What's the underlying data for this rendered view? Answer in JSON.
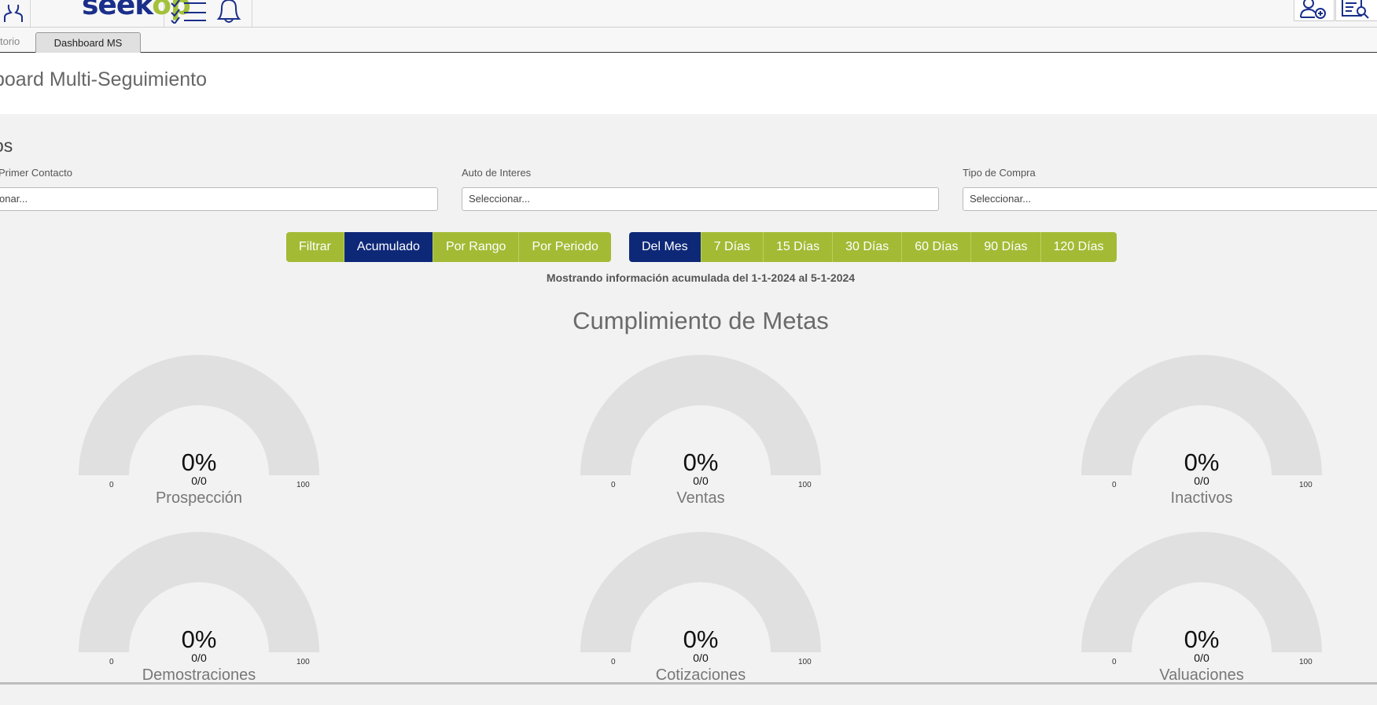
{
  "header": {
    "logo_main": "seek",
    "logo_accent": "op"
  },
  "tabs": {
    "previous": "torio",
    "active": "Dashboard MS"
  },
  "page": {
    "title": "board Multi-Seguimiento"
  },
  "filters": {
    "heading": "os",
    "fields": [
      {
        "label": "Primer Contacto",
        "placeholder": "onar..."
      },
      {
        "label": "Auto de Interes",
        "placeholder": "Seleccionar..."
      },
      {
        "label": "Tipo de Compra",
        "placeholder": "Seleccionar..."
      }
    ]
  },
  "mode_buttons": [
    {
      "label": "Filtrar",
      "active": false
    },
    {
      "label": "Acumulado",
      "active": true
    },
    {
      "label": "Por Rango",
      "active": false
    },
    {
      "label": "Por Periodo",
      "active": false
    }
  ],
  "period_buttons": [
    {
      "label": "Del Mes",
      "active": true
    },
    {
      "label": "7 Días",
      "active": false
    },
    {
      "label": "15 Días",
      "active": false
    },
    {
      "label": "30 Días",
      "active": false
    },
    {
      "label": "60 Días",
      "active": false
    },
    {
      "label": "90 Días",
      "active": false
    },
    {
      "label": "120 Días",
      "active": false
    }
  ],
  "info": "Mostrando información acumulada del 1-1-2024 al 5-1-2024",
  "section_title": "Cumplimiento de Metas",
  "gauges": [
    {
      "name": "Prospección",
      "percent": "0%",
      "fraction": "0/0",
      "min": "0",
      "max": "100",
      "value": 0
    },
    {
      "name": "Ventas",
      "percent": "0%",
      "fraction": "0/0",
      "min": "0",
      "max": "100",
      "value": 0
    },
    {
      "name": "Inactivos",
      "percent": "0%",
      "fraction": "0/0",
      "min": "0",
      "max": "100",
      "value": 0
    },
    {
      "name": "Demostraciones",
      "percent": "0%",
      "fraction": "0/0",
      "min": "0",
      "max": "100",
      "value": 0
    },
    {
      "name": "Cotizaciones",
      "percent": "0%",
      "fraction": "0/0",
      "min": "0",
      "max": "100",
      "value": 0
    },
    {
      "name": "Valuaciones",
      "percent": "0%",
      "fraction": "0/0",
      "min": "0",
      "max": "100",
      "value": 0
    }
  ],
  "colors": {
    "brand_blue": "#0e2878",
    "brand_green": "#a3ba35",
    "gauge_track": "#e0e0e0"
  }
}
